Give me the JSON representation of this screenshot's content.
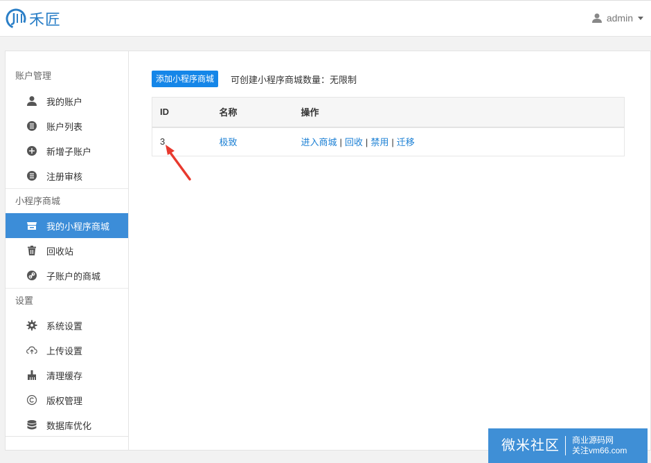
{
  "header": {
    "brand": "禾匠",
    "user": "admin",
    "user_icon": "user-icon"
  },
  "sidebar": {
    "sections": [
      {
        "title": "账户管理",
        "items": [
          {
            "label": "我的账户",
            "icon": "user-icon"
          },
          {
            "label": "账户列表",
            "icon": "list-icon"
          },
          {
            "label": "新增子账户",
            "icon": "plus-circle-icon"
          },
          {
            "label": "注册审核",
            "icon": "list-icon"
          }
        ]
      },
      {
        "title": "小程序商城",
        "items": [
          {
            "label": "我的小程序商城",
            "icon": "store-icon",
            "active": true
          },
          {
            "label": "回收站",
            "icon": "trash-icon"
          },
          {
            "label": "子账户的商城",
            "icon": "link-icon"
          }
        ]
      },
      {
        "title": "设置",
        "items": [
          {
            "label": "系统设置",
            "icon": "gear-icon"
          },
          {
            "label": "上传设置",
            "icon": "cloud-upload-icon"
          },
          {
            "label": "清理缓存",
            "icon": "brush-icon"
          },
          {
            "label": "版权管理",
            "icon": "copyright-icon"
          },
          {
            "label": "数据库优化",
            "icon": "database-icon"
          }
        ]
      }
    ]
  },
  "main": {
    "add_button": "添加小程序商城",
    "quota_text": "可创建小程序商城数量：无限制",
    "table": {
      "columns": [
        "ID",
        "名称",
        "操作"
      ],
      "rows": [
        {
          "id": "3",
          "name": "极致",
          "actions": [
            "进入商城",
            "回收",
            "禁用",
            "迁移"
          ]
        }
      ]
    }
  },
  "watermark": {
    "left": "微米社区",
    "line1": "商业源码网",
    "line2": "关注vm66.com"
  },
  "colors": {
    "accent": "#3c8dd8",
    "link": "#1a7fd4",
    "button": "#1586e8",
    "annotation": "#e8392e"
  }
}
